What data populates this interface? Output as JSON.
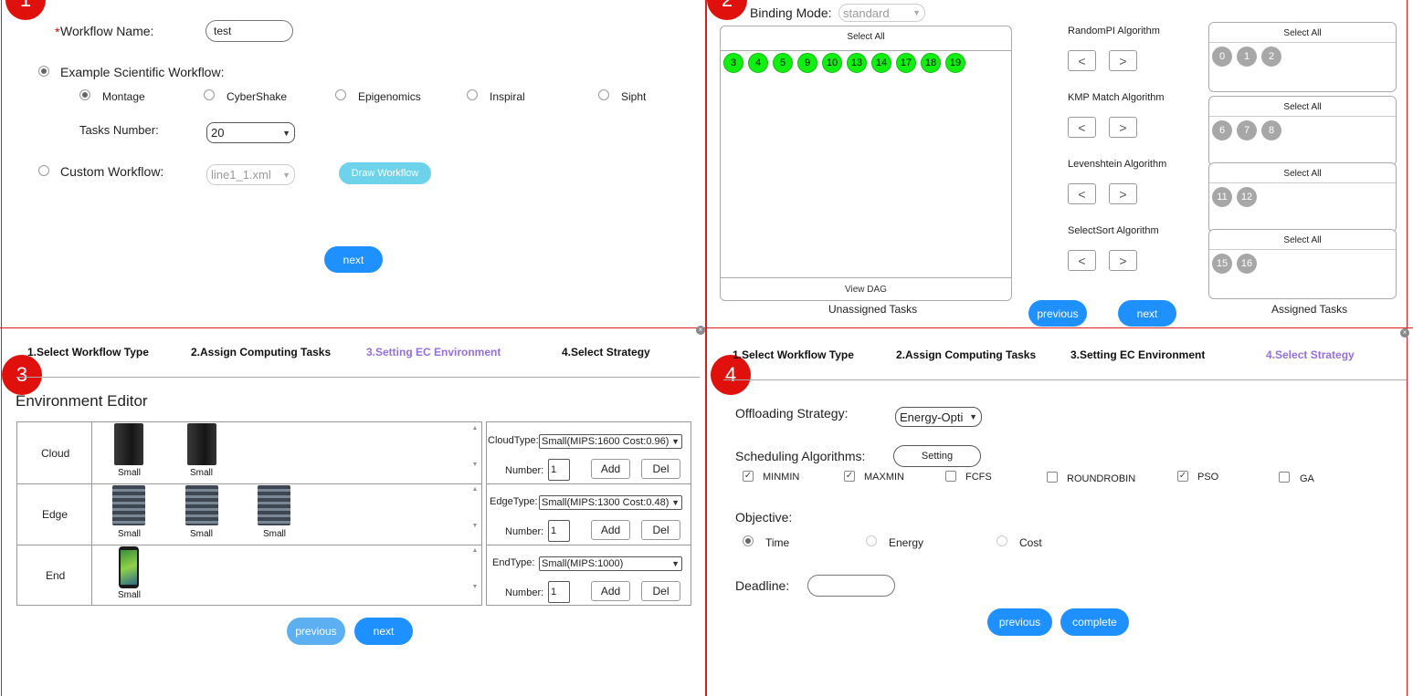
{
  "panels": {
    "p1": {
      "badge": "1"
    },
    "p2": {
      "badge": "2"
    },
    "p3": {
      "badge": "3"
    },
    "p4": {
      "badge": "4"
    }
  },
  "step1": {
    "workflow_name_label": "Workflow Name:",
    "workflow_name_value": "test",
    "example_label": "Example Scientific Workflow:",
    "options": [
      "Montage",
      "CyberShake",
      "Epigenomics",
      "Inspiral",
      "Sipht"
    ],
    "tasks_label": "Tasks Number:",
    "tasks_value": "20",
    "custom_label": "Custom Workflow:",
    "custom_value": "line1_1.xml",
    "draw_button": "Draw Workflow",
    "next_button": "next"
  },
  "step2": {
    "binding_label": "Binding Mode:",
    "binding_value": "standard",
    "select_all": "Select All",
    "unassigned": [
      "3",
      "4",
      "5",
      "9",
      "10",
      "13",
      "14",
      "17",
      "18",
      "19"
    ],
    "view_dag": "View DAG",
    "unassigned_caption": "Unassigned Tasks",
    "algorithms": [
      {
        "name": "RandomPI Algorithm",
        "tasks": [
          "0",
          "1",
          "2"
        ]
      },
      {
        "name": "KMP Match Algorithm",
        "tasks": [
          "6",
          "7",
          "8"
        ]
      },
      {
        "name": "Levenshtein Algorithm",
        "tasks": [
          "11",
          "12"
        ]
      },
      {
        "name": "SelectSort Algorithm",
        "tasks": [
          "15",
          "16"
        ]
      }
    ],
    "prev_arrow": "<",
    "next_arrow": ">",
    "assigned_caption": "Assigned Tasks",
    "previous_button": "previous",
    "next_button": "next"
  },
  "steps": {
    "s1": "1.Select Workflow Type",
    "s2": "2.Assign Computing Tasks",
    "s3": "3.Setting EC Environment",
    "s4": "4.Select Strategy"
  },
  "step3": {
    "title": "Environment Editor",
    "rows": [
      {
        "name": "Cloud",
        "devices": [
          "Small",
          "Small"
        ],
        "type_label": "CloudType:",
        "type_value": "Small(MIPS:1600 Cost:0.96)",
        "number_label": "Number:",
        "number_value": "1"
      },
      {
        "name": "Edge",
        "devices": [
          "Small",
          "Small",
          "Small"
        ],
        "type_label": "EdgeType:",
        "type_value": "Small(MIPS:1300 Cost:0.48)",
        "number_label": "Number:",
        "number_value": "1"
      },
      {
        "name": "End",
        "devices": [
          "Small"
        ],
        "type_label": "EndType:",
        "type_value": "Small(MIPS:1000)",
        "number_label": "Number:",
        "number_value": "1"
      }
    ],
    "add_button": "Add",
    "del_button": "Del",
    "previous_button": "previous",
    "next_button": "next"
  },
  "step4": {
    "offloading_label": "Offloading Strategy:",
    "offloading_value": "Energy-Opti",
    "scheduling_label": "Scheduling Algorithms:",
    "setting_button": "Setting",
    "algorithms": [
      {
        "name": "MINMIN",
        "checked": true
      },
      {
        "name": "MAXMIN",
        "checked": true
      },
      {
        "name": "FCFS",
        "checked": false
      },
      {
        "name": "ROUNDROBIN",
        "checked": false
      },
      {
        "name": "PSO",
        "checked": true
      },
      {
        "name": "GA",
        "checked": false
      }
    ],
    "objective_label": "Objective:",
    "objectives": [
      "Time",
      "Energy",
      "Cost"
    ],
    "deadline_label": "Deadline:",
    "deadline_value": "",
    "previous_button": "previous",
    "complete_button": "complete"
  },
  "colors": {
    "accent": "#1e90ff",
    "active_step": "#9370db",
    "badge": "#e0100c",
    "task_green": "#11ee11",
    "assigned_gray": "#a7a7a7"
  }
}
